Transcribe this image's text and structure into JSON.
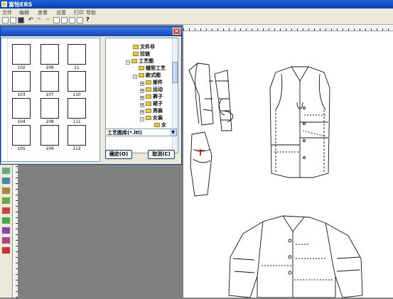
{
  "app": {
    "title": "富怡ERS"
  },
  "menu": [
    "文件",
    "编辑",
    "查看",
    "设置",
    "打印",
    "帮助"
  ],
  "dialog": {
    "thumbnails": [
      {
        "label": "102"
      },
      {
        "label": "106"
      },
      {
        "label": "11"
      },
      {
        "label": "103"
      },
      {
        "label": "107"
      },
      {
        "label": "110"
      },
      {
        "label": "104"
      },
      {
        "label": "108"
      },
      {
        "label": "111"
      },
      {
        "label": "105"
      },
      {
        "label": "109"
      },
      {
        "label": "112"
      }
    ],
    "tree": [
      {
        "label": "文件非",
        "indent": 2,
        "pm": ""
      },
      {
        "label": "拉链",
        "indent": 2,
        "pm": ""
      },
      {
        "label": "工艺图",
        "indent": 1,
        "pm": "-"
      },
      {
        "label": "缝型工艺",
        "indent": 2,
        "pm": ""
      },
      {
        "label": "款式图",
        "indent": 2,
        "pm": "-"
      },
      {
        "label": "部件",
        "indent": 3,
        "pm": "+"
      },
      {
        "label": "运动",
        "indent": 3,
        "pm": "+"
      },
      {
        "label": "裤子",
        "indent": 3,
        "pm": "+"
      },
      {
        "label": "裙子",
        "indent": 3,
        "pm": "+"
      },
      {
        "label": "男装",
        "indent": 3,
        "pm": "+"
      },
      {
        "label": "女装",
        "indent": 3,
        "pm": "-"
      },
      {
        "label": "女",
        "indent": 4,
        "pm": ""
      },
      {
        "label": "上衣",
        "indent": 4,
        "pm": ""
      }
    ],
    "filter": "工艺图库(*.ltl)",
    "ok_label": "确定(O)",
    "cancel_label": "取消(C)"
  }
}
